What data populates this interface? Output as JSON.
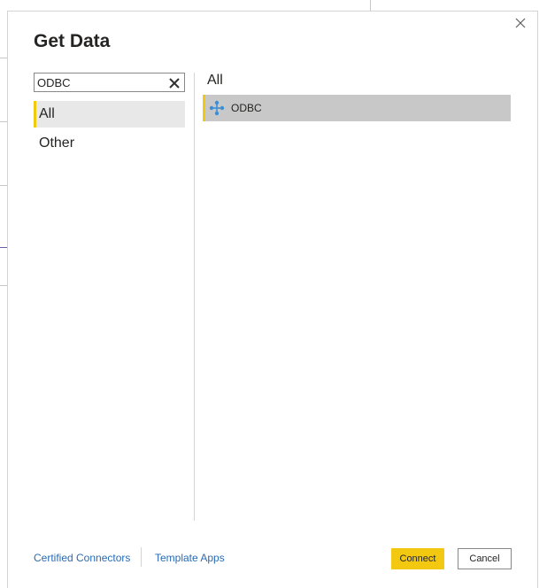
{
  "dialog": {
    "title": "Get Data"
  },
  "search": {
    "value": "ODBC",
    "placeholder": ""
  },
  "categories": {
    "items": [
      {
        "label": "All",
        "selected": true
      },
      {
        "label": "Other",
        "selected": false
      }
    ]
  },
  "results": {
    "section_label": "All",
    "items": [
      {
        "label": "ODBC",
        "icon": "odbc-connector-icon",
        "selected": true
      }
    ]
  },
  "footer": {
    "certified_link": "Certified Connectors",
    "template_link": "Template Apps",
    "connect_label": "Connect",
    "cancel_label": "Cancel"
  },
  "colors": {
    "accent_yellow": "#f2c811",
    "link_blue": "#2a6bb3",
    "selected_bg": "#c8c8c8",
    "category_selected_bg": "#e8e8e8",
    "icon_blue": "#3c8fd6"
  }
}
